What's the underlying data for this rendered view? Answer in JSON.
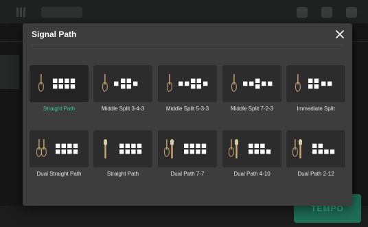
{
  "modal": {
    "title": "Signal Path",
    "close_label": "×"
  },
  "paths": [
    {
      "label": "Straight Path",
      "selected": true,
      "source": "guitar",
      "sources": 1,
      "blocks": [
        [
          4
        ],
        [
          4
        ]
      ]
    },
    {
      "label": "Middle Split 3-4-3",
      "selected": false,
      "source": "guitar",
      "sources": 1,
      "blocks": "split343"
    },
    {
      "label": "Middle Split 5-3-3",
      "selected": false,
      "source": "guitar",
      "sources": 1,
      "blocks": "split533"
    },
    {
      "label": "Middle Split 7-2-3",
      "selected": false,
      "source": "guitar",
      "sources": 1,
      "blocks": "split723"
    },
    {
      "label": "Immediate Split",
      "selected": false,
      "source": "guitar",
      "sources": 1,
      "blocks": "immediate"
    },
    {
      "label": "Dual Straight Path",
      "selected": false,
      "source": "guitar",
      "sources": 2,
      "blocks": "dualstraight"
    },
    {
      "label": "Straight Path",
      "selected": false,
      "source": "mic",
      "sources": 1,
      "blocks": "dualstraight"
    },
    {
      "label": "Dual Path 7-7",
      "selected": false,
      "source": "guitar-mic",
      "sources": 2,
      "blocks": "dualstraight"
    },
    {
      "label": "Dual Path 4-10",
      "selected": false,
      "source": "guitar-mic",
      "sources": 2,
      "blocks": "dual410"
    },
    {
      "label": "Dual Path 2-12",
      "selected": false,
      "source": "guitar-mic",
      "sources": 2,
      "blocks": "dual212"
    }
  ],
  "background": {
    "tempo_label": "TEMPO"
  },
  "colors": {
    "accent": "#3fc6a0",
    "modal_bg": "#3c3d3c",
    "tile_bg": "#2b2c2b",
    "guitar": "#c9a872"
  }
}
